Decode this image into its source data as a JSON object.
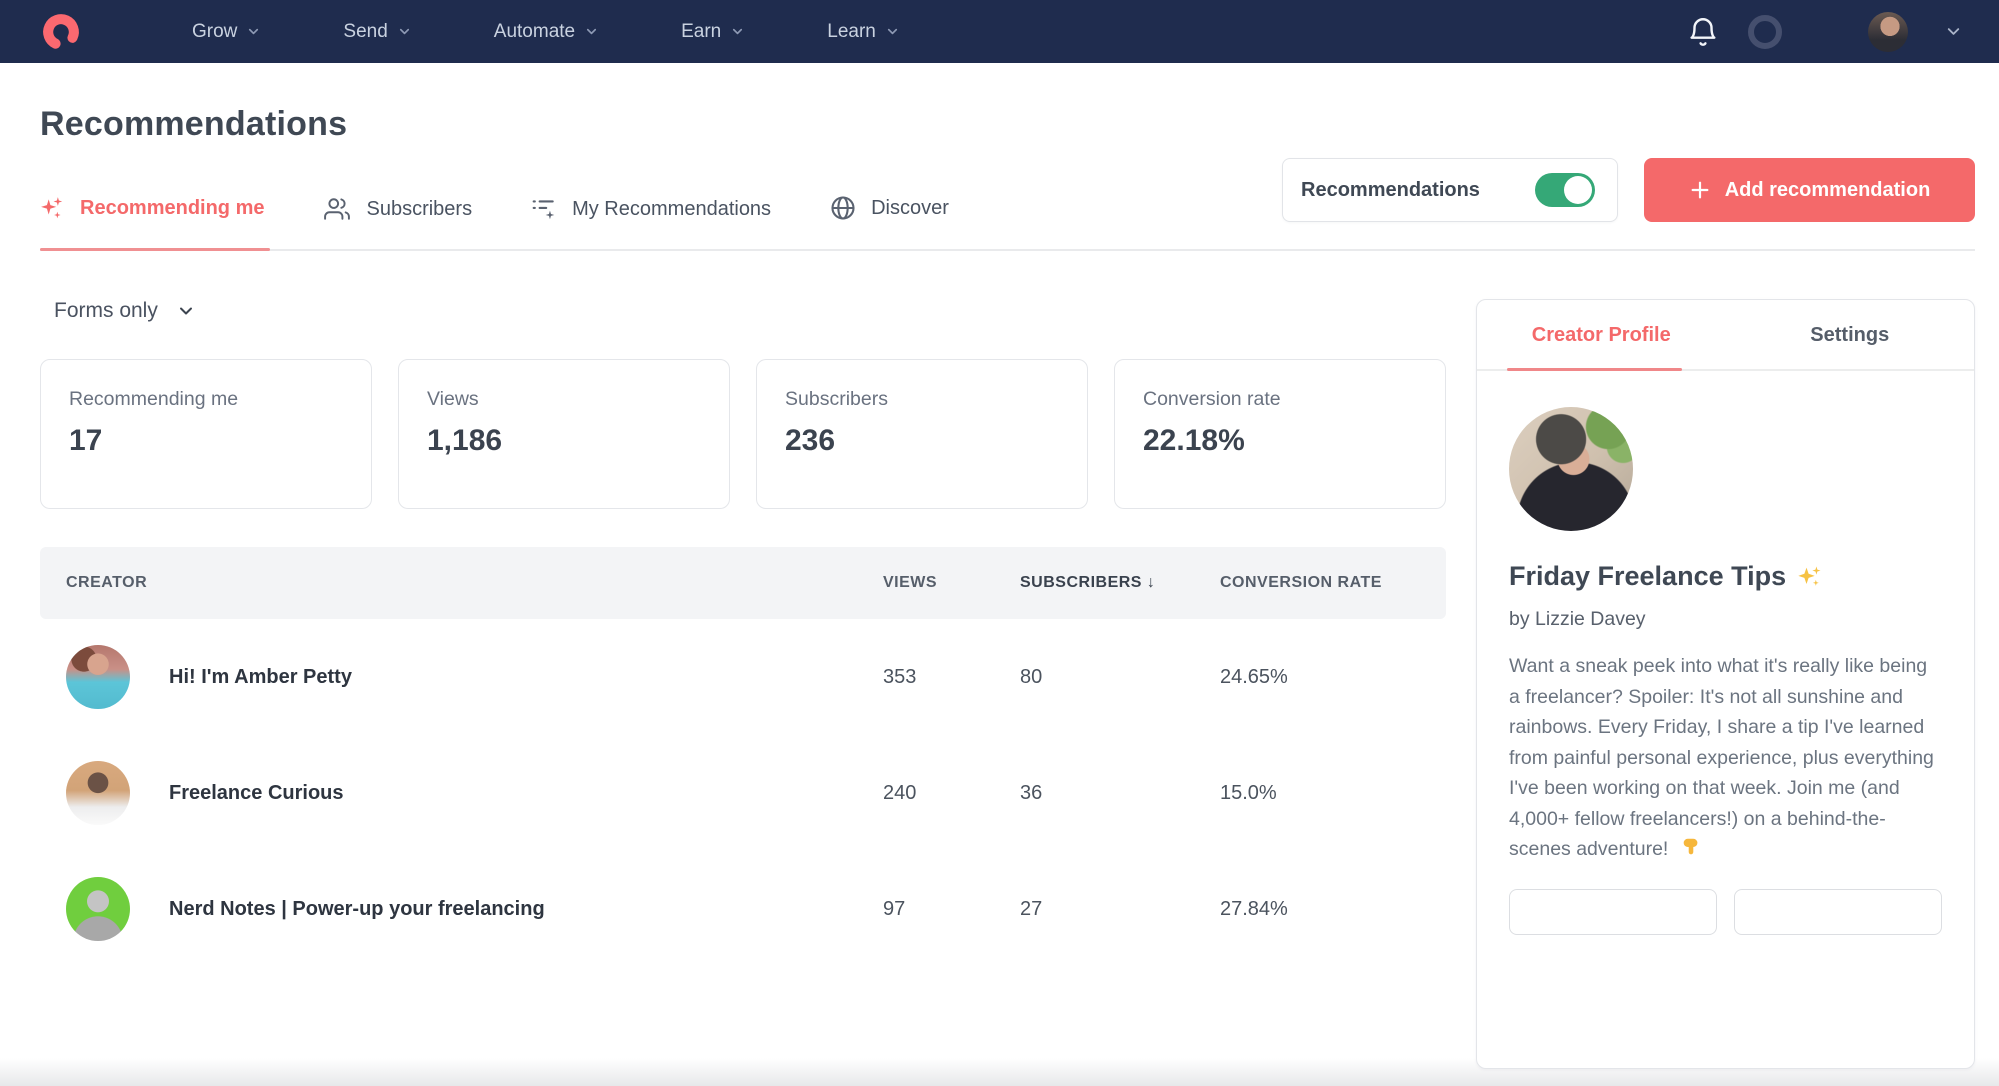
{
  "nav": {
    "items": [
      {
        "label": "Grow"
      },
      {
        "label": "Send"
      },
      {
        "label": "Automate"
      },
      {
        "label": "Earn"
      },
      {
        "label": "Learn"
      }
    ]
  },
  "page": {
    "title": "Recommendations"
  },
  "tabs": [
    {
      "label": "Recommending me",
      "active": true
    },
    {
      "label": "Subscribers",
      "active": false
    },
    {
      "label": "My Recommendations",
      "active": false
    },
    {
      "label": "Discover",
      "active": false
    }
  ],
  "controls": {
    "toggle_label": "Recommendations",
    "toggle_state": "on",
    "add_button_label": "Add recommendation"
  },
  "filter": {
    "value": "Forms only"
  },
  "stats": [
    {
      "label": "Recommending me",
      "value": "17"
    },
    {
      "label": "Views",
      "value": "1,186"
    },
    {
      "label": "Subscribers",
      "value": "236"
    },
    {
      "label": "Conversion rate",
      "value": "22.18%"
    }
  ],
  "table": {
    "header": {
      "creator": "CREATOR",
      "views": "VIEWS",
      "subscribers": "SUBSCRIBERS",
      "conversion": "CONVERSION RATE"
    },
    "sort_column": "SUBSCRIBERS",
    "sort_indicator": "↓",
    "rows": [
      {
        "creator": "Hi! I'm Amber Petty",
        "views": "353",
        "subscribers": "80",
        "conversion_rate": "24.65%"
      },
      {
        "creator": "Freelance Curious",
        "views": "240",
        "subscribers": "36",
        "conversion_rate": "15.0%"
      },
      {
        "creator": "Nerd Notes | Power-up your freelancing",
        "views": "97",
        "subscribers": "27",
        "conversion_rate": "27.84%"
      }
    ]
  },
  "panel": {
    "tabs": [
      {
        "label": "Creator Profile",
        "active": true
      },
      {
        "label": "Settings",
        "active": false
      }
    ],
    "title": "Friday Freelance Tips",
    "title_emoji": "✨",
    "byline": "by Lizzie Davey",
    "description": "Want a sneak peek into what it's really like being a freelancer? Spoiler: It's not all sunshine and rainbows. Every Friday, I share a tip I've learned from painful personal experience, plus everything I've been working on that week. Join me (and 4,000+ fellow freelancers!) on a behind-the-scenes adventure!",
    "description_emoji": "👇"
  },
  "colors": {
    "nav_background": "#1f2c4e",
    "brand_coral": "#f4696a",
    "toggle_green": "#35a877",
    "active_tab": "#f4696a",
    "heading_text": "#3f4854",
    "body_text": "#6b7480",
    "table_header_bg": "#f3f4f6"
  }
}
